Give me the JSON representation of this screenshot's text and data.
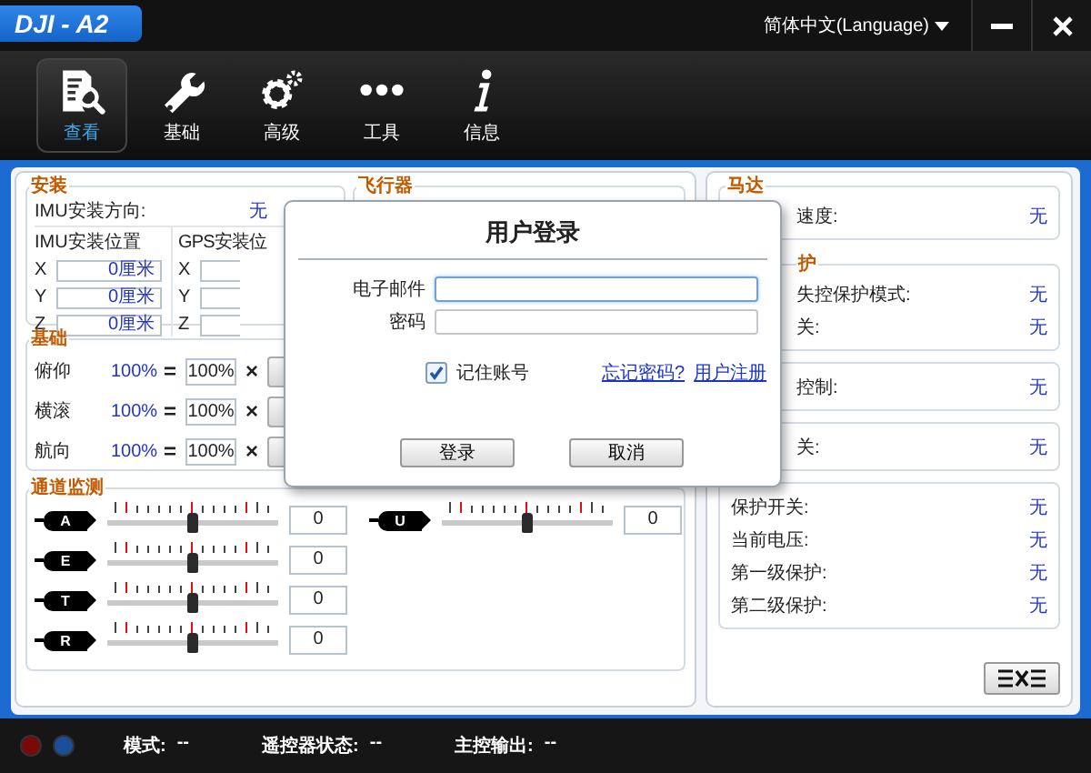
{
  "window": {
    "title": "DJI - A2",
    "language": "简体中文(Language)",
    "controls": [
      {
        "kind": "minimize"
      },
      {
        "kind": "close"
      }
    ]
  },
  "toolbar": [
    {
      "label": "查看",
      "selected": true
    },
    {
      "label": "基础",
      "selected": false
    },
    {
      "label": "高级",
      "selected": false
    },
    {
      "label": "工具",
      "selected": false
    },
    {
      "label": "信息",
      "selected": false
    }
  ],
  "install": {
    "title": "安装",
    "direction_label": "IMU安装方向:",
    "direction_value": "无",
    "imu": {
      "title": "IMU安装位置",
      "axes": [
        {
          "axis": "X",
          "value": "0厘米"
        },
        {
          "axis": "Y",
          "value": "0厘米"
        },
        {
          "axis": "Z",
          "value": "0厘米"
        }
      ]
    },
    "gps": {
      "title": "GPS安装位",
      "axes": [
        "X",
        "Y",
        "Z"
      ]
    }
  },
  "aircraft": {
    "title": "飞行器"
  },
  "basic": {
    "title": "基础",
    "rows": [
      {
        "label": "俯仰",
        "total": "100%",
        "equals": "=",
        "gain": "100%",
        "times": "×"
      },
      {
        "label": "横滚",
        "total": "100%",
        "equals": "=",
        "gain": "100%",
        "times": "×"
      },
      {
        "label": "航向",
        "total": "100%",
        "equals": "=",
        "gain": "100%",
        "times": "×"
      }
    ]
  },
  "channels": {
    "title": "通道监测",
    "left": [
      {
        "name": "A",
        "level": 0.5,
        "value": "0"
      },
      {
        "name": "E",
        "level": 0.5,
        "value": "0"
      },
      {
        "name": "T",
        "level": 0.5,
        "value": "0"
      },
      {
        "name": "R",
        "level": 0.5,
        "value": "0"
      }
    ],
    "right": [
      {
        "name": "U",
        "level": 0.5,
        "value": "0"
      }
    ]
  },
  "right_panel": [
    {
      "title": "马达",
      "title_partly_hidden": false,
      "rows": [
        {
          "label": "速度:",
          "value": "无",
          "partly_hidden": true
        }
      ]
    },
    {
      "title": "护",
      "title_partly_hidden": true,
      "rows": [
        {
          "label": "失控保护模式:",
          "value": "无",
          "partly_hidden": true
        },
        {
          "label": "关:",
          "value": "无",
          "partly_hidden": true
        }
      ]
    },
    {
      "rows": [
        {
          "label": "控制:",
          "value": "无",
          "partly_hidden": true
        }
      ]
    },
    {
      "rows": [
        {
          "label": "关:",
          "value": "无",
          "partly_hidden": true
        }
      ]
    },
    {
      "rows": [
        {
          "label": "保护开关:",
          "value": "无",
          "partly_hidden": false
        },
        {
          "label": "当前电压:",
          "value": "无",
          "partly_hidden": false
        },
        {
          "label": "第一级保护:",
          "value": "无",
          "partly_hidden": false
        },
        {
          "label": "第二级保护:",
          "value": "无",
          "partly_hidden": false
        }
      ]
    }
  ],
  "status_bar": {
    "lights": [
      {
        "color": "#7a0a0a"
      },
      {
        "color": "#1b4f9c"
      }
    ],
    "items": [
      {
        "label": "模式:",
        "value": "--"
      },
      {
        "label": "遥控器状态:",
        "value": "--"
      },
      {
        "label": "主控输出:",
        "value": "--"
      }
    ]
  },
  "login_dialog": {
    "title": "用户登录",
    "fields": [
      {
        "label": "电子邮件",
        "focused": true
      },
      {
        "label": "密码",
        "focused": false
      }
    ],
    "remember": {
      "label": "记住账号",
      "checked": true
    },
    "links": [
      "忘记密码?",
      "用户注册"
    ],
    "buttons": [
      "登录",
      "取消"
    ]
  }
}
